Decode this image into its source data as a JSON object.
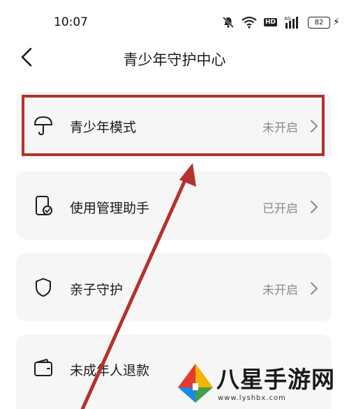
{
  "status_bar": {
    "time": "10:07",
    "hd": "HD",
    "network": "4G",
    "battery": "82"
  },
  "header": {
    "title": "青少年守护中心"
  },
  "items": [
    {
      "label": "青少年模式",
      "status": "未开启",
      "icon": "umbrella-icon"
    },
    {
      "label": "使用管理助手",
      "status": "已开启",
      "icon": "phone-check-icon"
    },
    {
      "label": "亲子守护",
      "status": "未开启",
      "icon": "shield-icon"
    },
    {
      "label": "未成年人退款",
      "status": "",
      "icon": "wallet-icon"
    }
  ],
  "annotation": {
    "highlight_color": "#b5312c"
  },
  "watermark": {
    "text": "八星手游网",
    "url": "www.lyshbx.com"
  },
  "colors": {
    "card_bg": "#f6f6f7",
    "status_text": "#8a8a8a"
  }
}
